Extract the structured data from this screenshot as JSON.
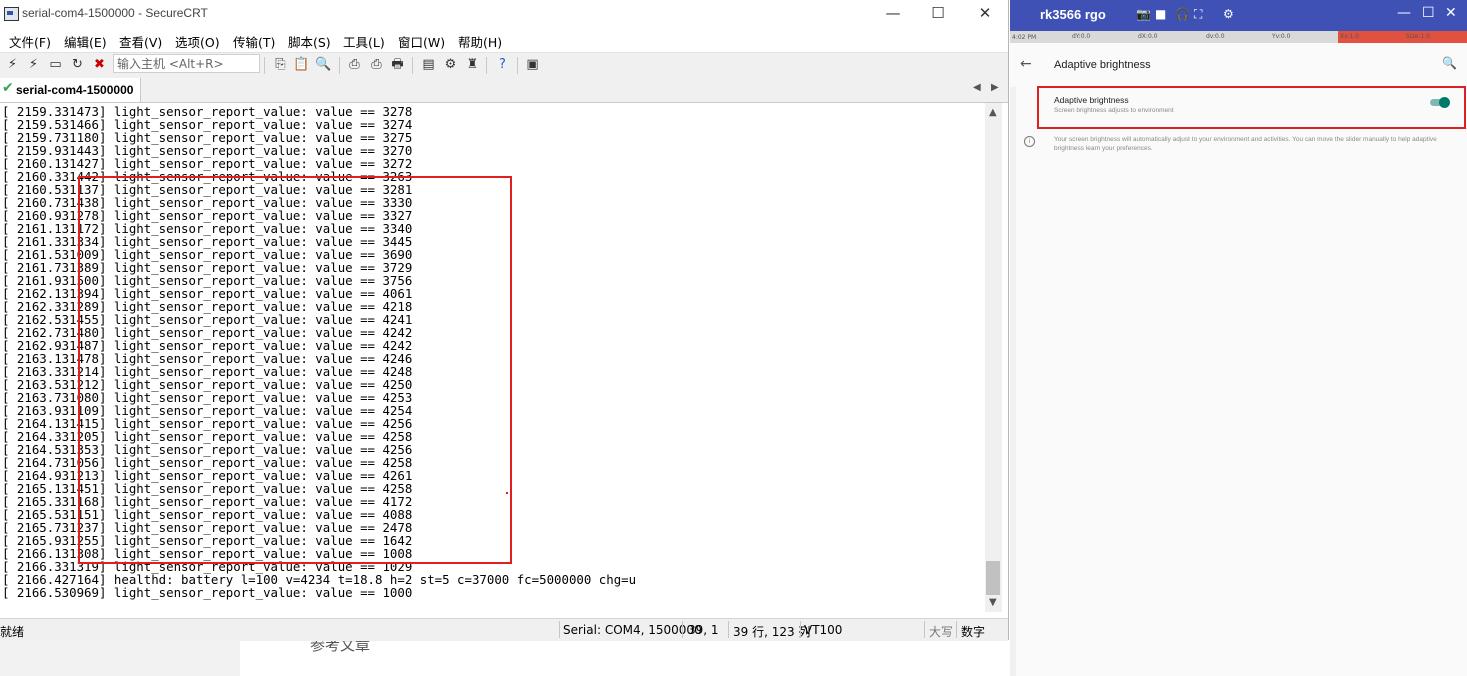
{
  "background": {
    "text": "参考文章"
  },
  "securecrt": {
    "title": "serial-com4-1500000 - SecureCRT",
    "window_controls": {
      "minimize": "—",
      "maximize": "☐",
      "close": "✕"
    },
    "menu": [
      "文件(F)",
      "编辑(E)",
      "查看(V)",
      "选项(O)",
      "传输(T)",
      "脚本(S)",
      "工具(L)",
      "窗口(W)",
      "帮助(H)"
    ],
    "quick_connect_placeholder": "输入主机 <Alt+R>",
    "tab": {
      "label": "serial-com4-1500000"
    },
    "terminal_lines": [
      "[ 2159.331473] light_sensor_report_value: value == 3278",
      "[ 2159.531466] light_sensor_report_value: value == 3274",
      "[ 2159.731180] light_sensor_report_value: value == 3275",
      "[ 2159.931443] light_sensor_report_value: value == 3270",
      "[ 2160.131427] light_sensor_report_value: value == 3272",
      "[ 2160.331442] light_sensor_report_value: value == 3263",
      "[ 2160.531137] light_sensor_report_value: value == 3281",
      "[ 2160.731438] light_sensor_report_value: value == 3330",
      "[ 2160.931278] light_sensor_report_value: value == 3327",
      "[ 2161.131172] light_sensor_report_value: value == 3340",
      "[ 2161.331334] light_sensor_report_value: value == 3445",
      "[ 2161.531009] light_sensor_report_value: value == 3690",
      "[ 2161.731389] light_sensor_report_value: value == 3729",
      "[ 2161.931500] light_sensor_report_value: value == 3756",
      "[ 2162.131394] light_sensor_report_value: value == 4061",
      "[ 2162.331289] light_sensor_report_value: value == 4218",
      "[ 2162.531455] light_sensor_report_value: value == 4241",
      "[ 2162.731480] light_sensor_report_value: value == 4242",
      "[ 2162.931487] light_sensor_report_value: value == 4242",
      "[ 2163.131478] light_sensor_report_value: value == 4246",
      "[ 2163.331214] light_sensor_report_value: value == 4248",
      "[ 2163.531212] light_sensor_report_value: value == 4250",
      "[ 2163.731080] light_sensor_report_value: value == 4253",
      "[ 2163.931109] light_sensor_report_value: value == 4254",
      "[ 2164.131415] light_sensor_report_value: value == 4256",
      "[ 2164.331205] light_sensor_report_value: value == 4258",
      "[ 2164.531353] light_sensor_report_value: value == 4256",
      "[ 2164.731056] light_sensor_report_value: value == 4258",
      "[ 2164.931213] light_sensor_report_value: value == 4261",
      "[ 2165.131451] light_sensor_report_value: value == 4258",
      "[ 2165.331168] light_sensor_report_value: value == 4172",
      "[ 2165.531151] light_sensor_report_value: value == 4088",
      "[ 2165.731237] light_sensor_report_value: value == 2478",
      "[ 2165.931255] light_sensor_report_value: value == 1642",
      "[ 2166.131308] light_sensor_report_value: value == 1008",
      "[ 2166.331319] light_sensor_report_value: value == 1029",
      "[ 2166.427164] healthd: battery l=100 v=4234 t=18.8 h=2 st=5 c=37000 fc=5000000 chg=u",
      "[ 2166.530969] light_sensor_report_value: value == 1000"
    ],
    "status": {
      "ready": "就绪",
      "connection": "Serial: COM4, 1500000",
      "cursor": "39,  1",
      "position": "39 行, 123 列",
      "emulation": "VT100",
      "caps": "大写",
      "num": "数字"
    }
  },
  "mirror": {
    "title": "rk3566 rgo",
    "statusbar_time": "4:02 PM",
    "statusbar_values": [
      "dY:0.0",
      "dX:0.0",
      "dv:0.0",
      "Yv:0.0",
      "Xv:1.0",
      "Size:1.0"
    ],
    "header_title": "Adaptive brightness",
    "setting_title": "Adaptive brightness",
    "setting_subtitle": "Screen brightness adjusts to environment",
    "toggle_on": true,
    "info_text": "Your screen brightness will automatically adjust to your environment and activities. You can move the slider manually to help adaptive brightness learn your preferences.",
    "accent": "#3f51b5",
    "toggle_color": "#00796b"
  },
  "annotation_color": "#e02020"
}
